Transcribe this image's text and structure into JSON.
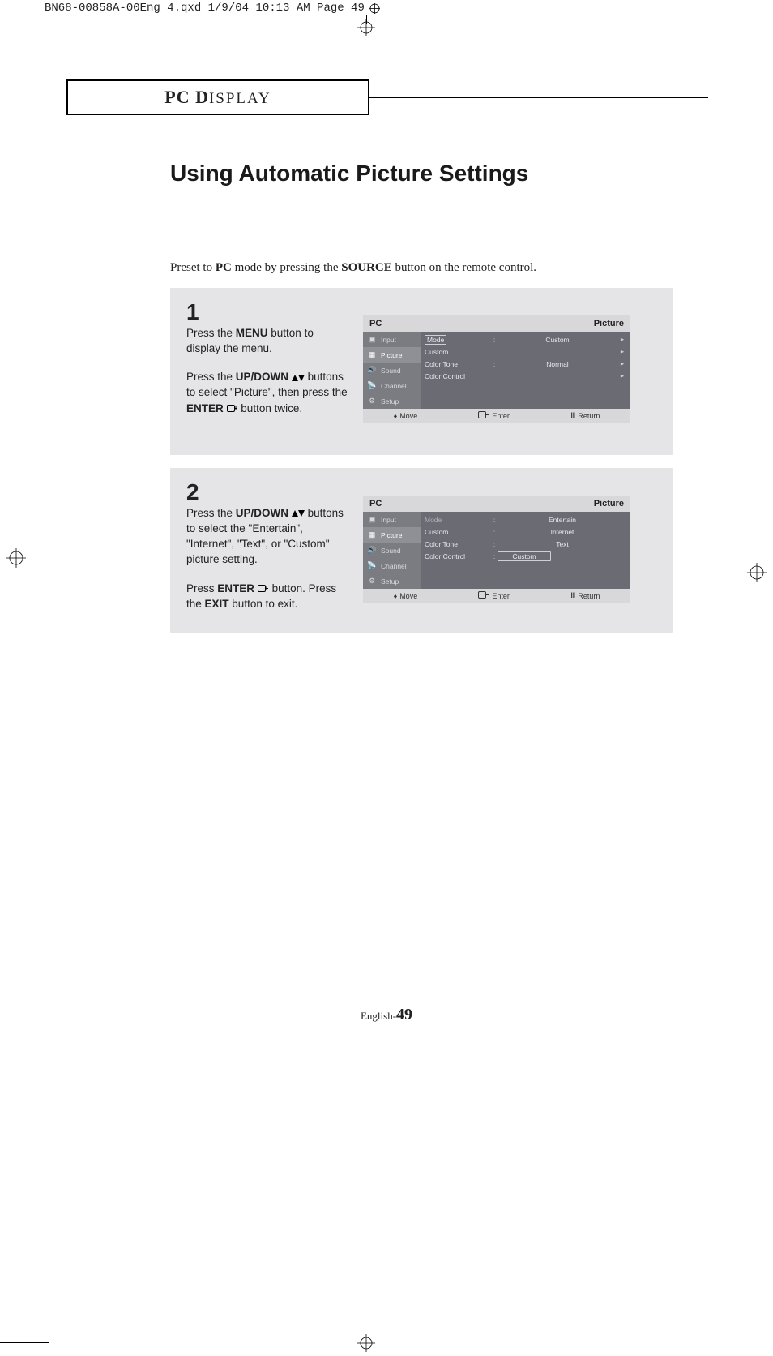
{
  "print_header": "BN68-00858A-00Eng 4.qxd  1/9/04 10:13 AM  Page 49",
  "section_caption_prefix": "PC D",
  "section_caption_rest": "ISPLAY",
  "title": "Using Automatic Picture Settings",
  "intro_pre": "Preset to ",
  "intro_pc": "PC",
  "intro_mid": " mode by pressing the ",
  "intro_src": "SOURCE",
  "intro_post": " button on the remote control.",
  "step1": {
    "num": "1",
    "p1a": "Press the ",
    "p1b": "MENU",
    "p1c": " button to display the menu.",
    "p2a": "Press the ",
    "p2b": "UP/DOWN",
    "p2c": " buttons to select \"Picture\", then press the ",
    "p2d": "ENTER",
    "p2e": " button twice."
  },
  "step2": {
    "num": "2",
    "p1a": "Press the ",
    "p1b": "UP/DOWN",
    "p1c": " buttons to select the \"Entertain\", \"Internet\", \"Text\", or \"Custom\" picture setting.",
    "p2a": "Press ",
    "p2b": "ENTER",
    "p2c": " button. Press the ",
    "p2d": "EXIT",
    "p2e": " button to exit."
  },
  "osd": {
    "pc": "PC",
    "picture": "Picture",
    "sidebar": [
      "Input",
      "Picture",
      "Sound",
      "Channel",
      "Setup"
    ],
    "rows1": [
      {
        "label": "Mode",
        "value": "Custom",
        "boxed": true
      },
      {
        "label": "Custom",
        "value": ""
      },
      {
        "label": "Color Tone",
        "value": "Normal"
      },
      {
        "label": "Color Control",
        "value": ""
      }
    ],
    "rows2": [
      {
        "label": "Mode",
        "value": "Entertain",
        "dim": true
      },
      {
        "label": "Custom",
        "value": "Internet"
      },
      {
        "label": "Color Tone",
        "value": "Text"
      },
      {
        "label": "Color Control",
        "value": "Custom",
        "valboxed": true
      }
    ],
    "footer": {
      "move": "Move",
      "enter": "Enter",
      "return": "Return"
    }
  },
  "page_prefix": "English-",
  "page_num": "49"
}
